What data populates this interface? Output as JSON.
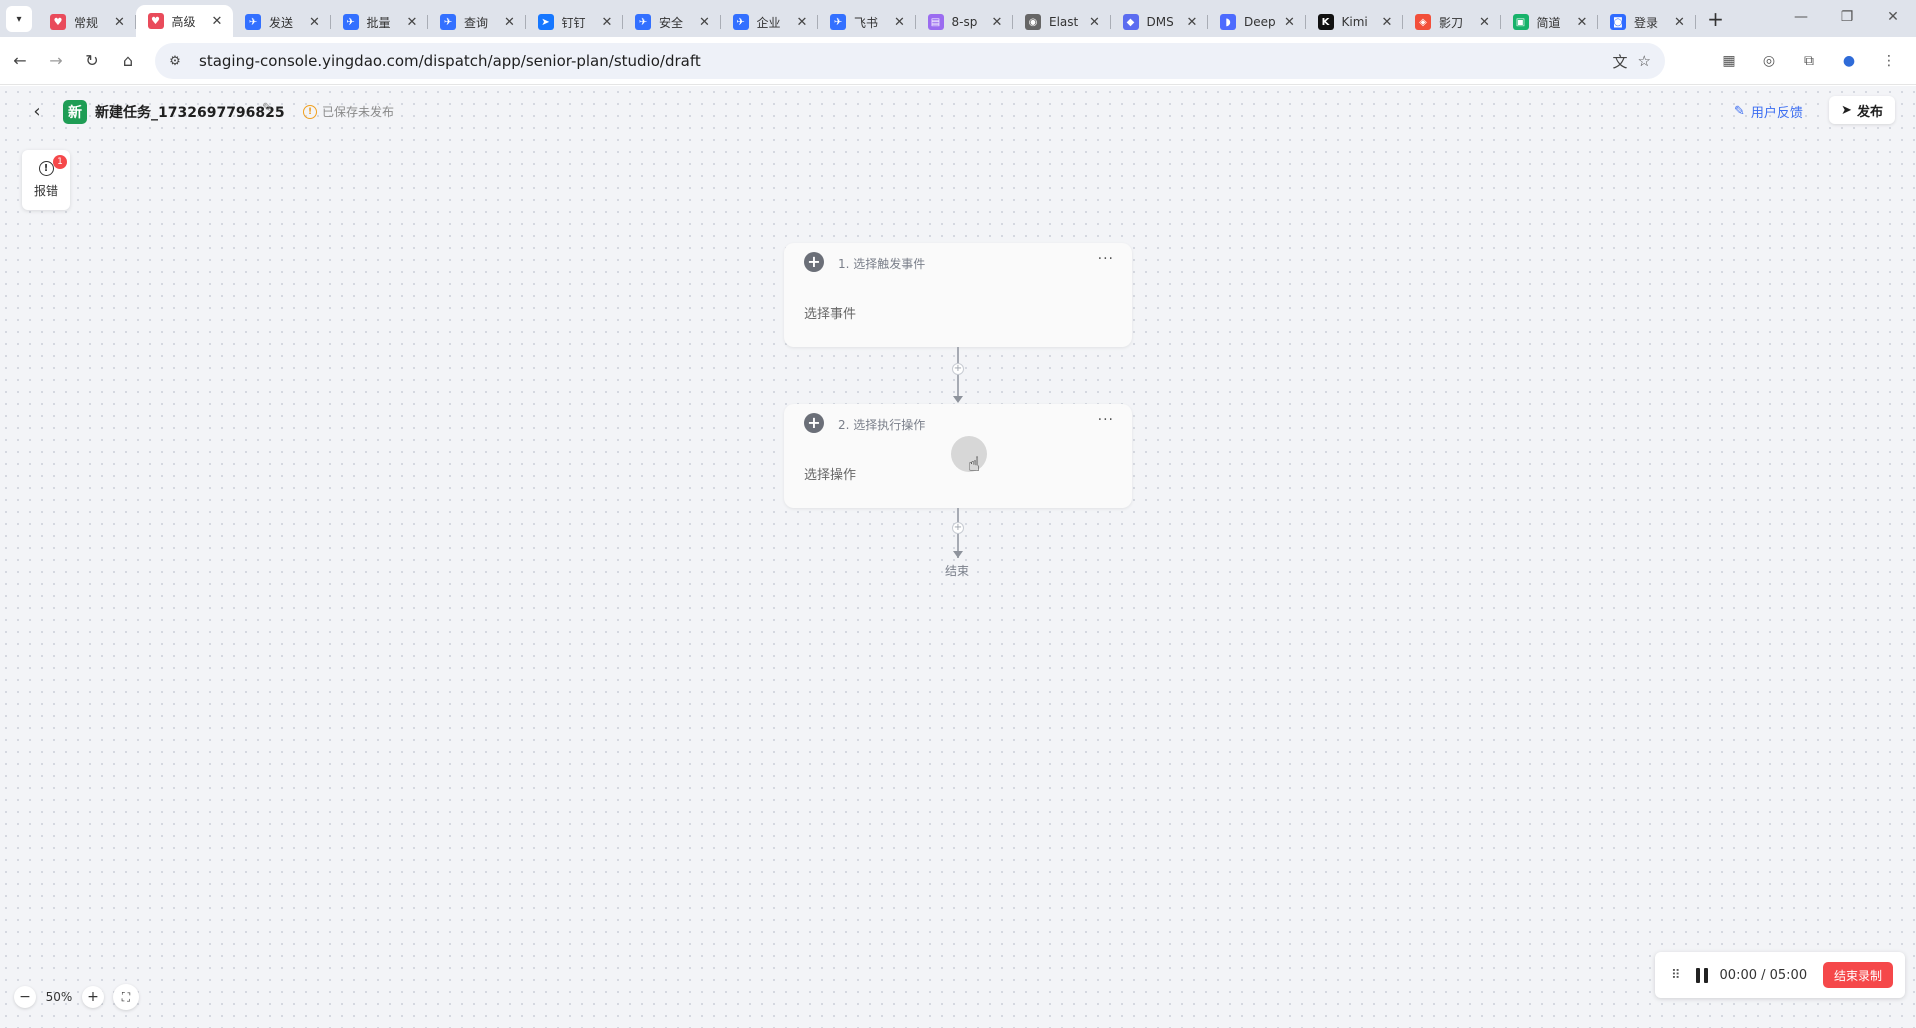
{
  "browser": {
    "tabs": [
      {
        "title": "常规",
        "icon": "map-pin-icon",
        "color": "#e94b5b",
        "active": false
      },
      {
        "title": "高级",
        "icon": "map-pin-icon",
        "color": "#e94b5b",
        "active": true
      },
      {
        "title": "发送",
        "icon": "feishu-icon",
        "color": "#3370ff",
        "active": false
      },
      {
        "title": "批量",
        "icon": "feishu-icon",
        "color": "#3370ff",
        "active": false
      },
      {
        "title": "查询",
        "icon": "feishu-icon",
        "color": "#3370ff",
        "active": false
      },
      {
        "title": "钉钉",
        "icon": "dingtalk-icon",
        "color": "#1677ff",
        "active": false
      },
      {
        "title": "安全",
        "icon": "feishu-icon",
        "color": "#3370ff",
        "active": false
      },
      {
        "title": "企业",
        "icon": "feishu-icon",
        "color": "#3370ff",
        "active": false
      },
      {
        "title": "飞书",
        "icon": "feishu-icon",
        "color": "#3370ff",
        "active": false
      },
      {
        "title": "8-sp",
        "icon": "note-icon",
        "color": "#9b6cf0",
        "active": false
      },
      {
        "title": "Elast",
        "icon": "elastic-icon",
        "color": "#666666",
        "active": false
      },
      {
        "title": "DMS",
        "icon": "dms-icon",
        "color": "#5b6cf0",
        "active": false
      },
      {
        "title": "Deep",
        "icon": "deepseek-icon",
        "color": "#4d6bfe",
        "active": false
      },
      {
        "title": "Kimi",
        "icon": "kimi-icon",
        "color": "#111111",
        "active": false
      },
      {
        "title": "影刀",
        "icon": "yingdao-icon",
        "color": "#f24f3a",
        "active": false
      },
      {
        "title": "简道",
        "icon": "jiandao-icon",
        "color": "#17b26a",
        "active": false
      },
      {
        "title": "登录",
        "icon": "login-icon",
        "color": "#2f6bff",
        "active": false
      }
    ],
    "url": "staging-console.yingdao.com/dispatch/app/senior-plan/studio/draft"
  },
  "app": {
    "task_logo": "新",
    "task_name": "新建任务_1732697796825",
    "save_status": "已保存未发布",
    "feedback_label": "用户反馈",
    "publish_label": "发布",
    "error_panel": {
      "label": "报错",
      "count": "1"
    }
  },
  "flow": {
    "nodes": [
      {
        "title": "1. 选择触发事件",
        "body": "选择事件"
      },
      {
        "title": "2. 选择执行操作",
        "body": "选择操作"
      }
    ],
    "end_label": "结束"
  },
  "controls": {
    "zoom": "50%",
    "recording": {
      "time": "00:00 / 05:00",
      "stop_label": "结束录制"
    }
  },
  "colors": {
    "accent": "#3b6df2",
    "danger": "#f5484a",
    "brand_green": "#1f9d55"
  }
}
